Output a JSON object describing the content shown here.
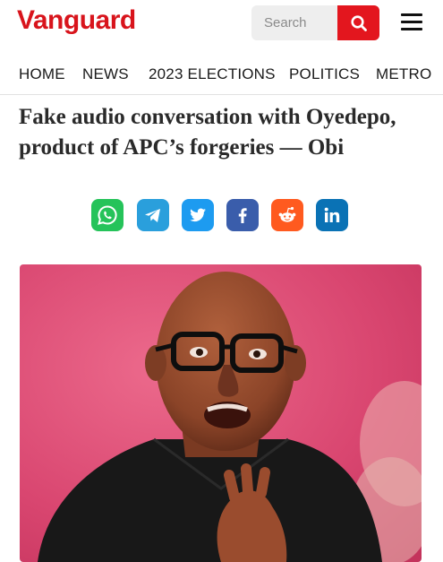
{
  "header": {
    "logo": "Vanguard",
    "search_placeholder": "Search",
    "brand_color": "#d8141c"
  },
  "nav": {
    "items": [
      "HOME",
      "NEWS",
      "2023 ELECTIONS",
      "POLITICS",
      "METRO"
    ]
  },
  "article": {
    "headline": "Fake audio conversation with Oyedepo, product of APC’s forgeries — Obi"
  },
  "share": [
    {
      "icon": "whatsapp-icon",
      "color": "#25c35a"
    },
    {
      "icon": "telegram-icon",
      "color": "#2a9fdc"
    },
    {
      "icon": "twitter-icon",
      "color": "#1d9bf0"
    },
    {
      "icon": "facebook-icon",
      "color": "#3a5dab"
    },
    {
      "icon": "reddit-icon",
      "color": "#ff5a1f"
    },
    {
      "icon": "linkedin-icon",
      "color": "#0a72b5"
    }
  ],
  "photo": {
    "icon": "article-photo",
    "background": "#df4f74"
  }
}
